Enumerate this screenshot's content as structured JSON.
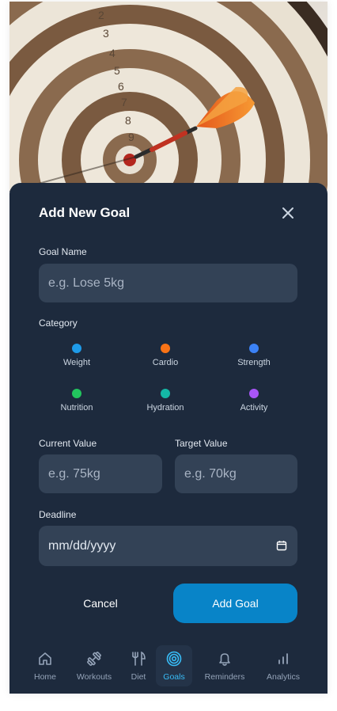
{
  "form": {
    "title": "Add New Goal",
    "goal_name_label": "Goal Name",
    "goal_name_placeholder": "e.g. Lose 5kg",
    "category_label": "Category",
    "categories": [
      {
        "label": "Weight",
        "color": "#1e9be9"
      },
      {
        "label": "Cardio",
        "color": "#f97316"
      },
      {
        "label": "Strength",
        "color": "#3b82f6"
      },
      {
        "label": "Nutrition",
        "color": "#22c55e"
      },
      {
        "label": "Hydration",
        "color": "#14b8a6"
      },
      {
        "label": "Activity",
        "color": "#a855f7"
      }
    ],
    "current_label": "Current Value",
    "current_placeholder": "e.g. 75kg",
    "target_label": "Target Value",
    "target_placeholder": "e.g. 70kg",
    "deadline_label": "Deadline",
    "deadline_placeholder": "mm/dd/yyyy",
    "cancel_label": "Cancel",
    "submit_label": "Add Goal"
  },
  "nav": {
    "items": [
      {
        "label": "Home",
        "icon": "home-icon"
      },
      {
        "label": "Workouts",
        "icon": "dumbbell-icon"
      },
      {
        "label": "Diet",
        "icon": "utensils-icon"
      },
      {
        "label": "Goals",
        "icon": "target-icon",
        "active": true
      },
      {
        "label": "Reminders",
        "icon": "bell-icon"
      },
      {
        "label": "Analytics",
        "icon": "bar-chart-icon"
      }
    ]
  },
  "theme": {
    "accent": "#0884c8",
    "sheet": "#1d2a3d",
    "field": "#334256"
  }
}
